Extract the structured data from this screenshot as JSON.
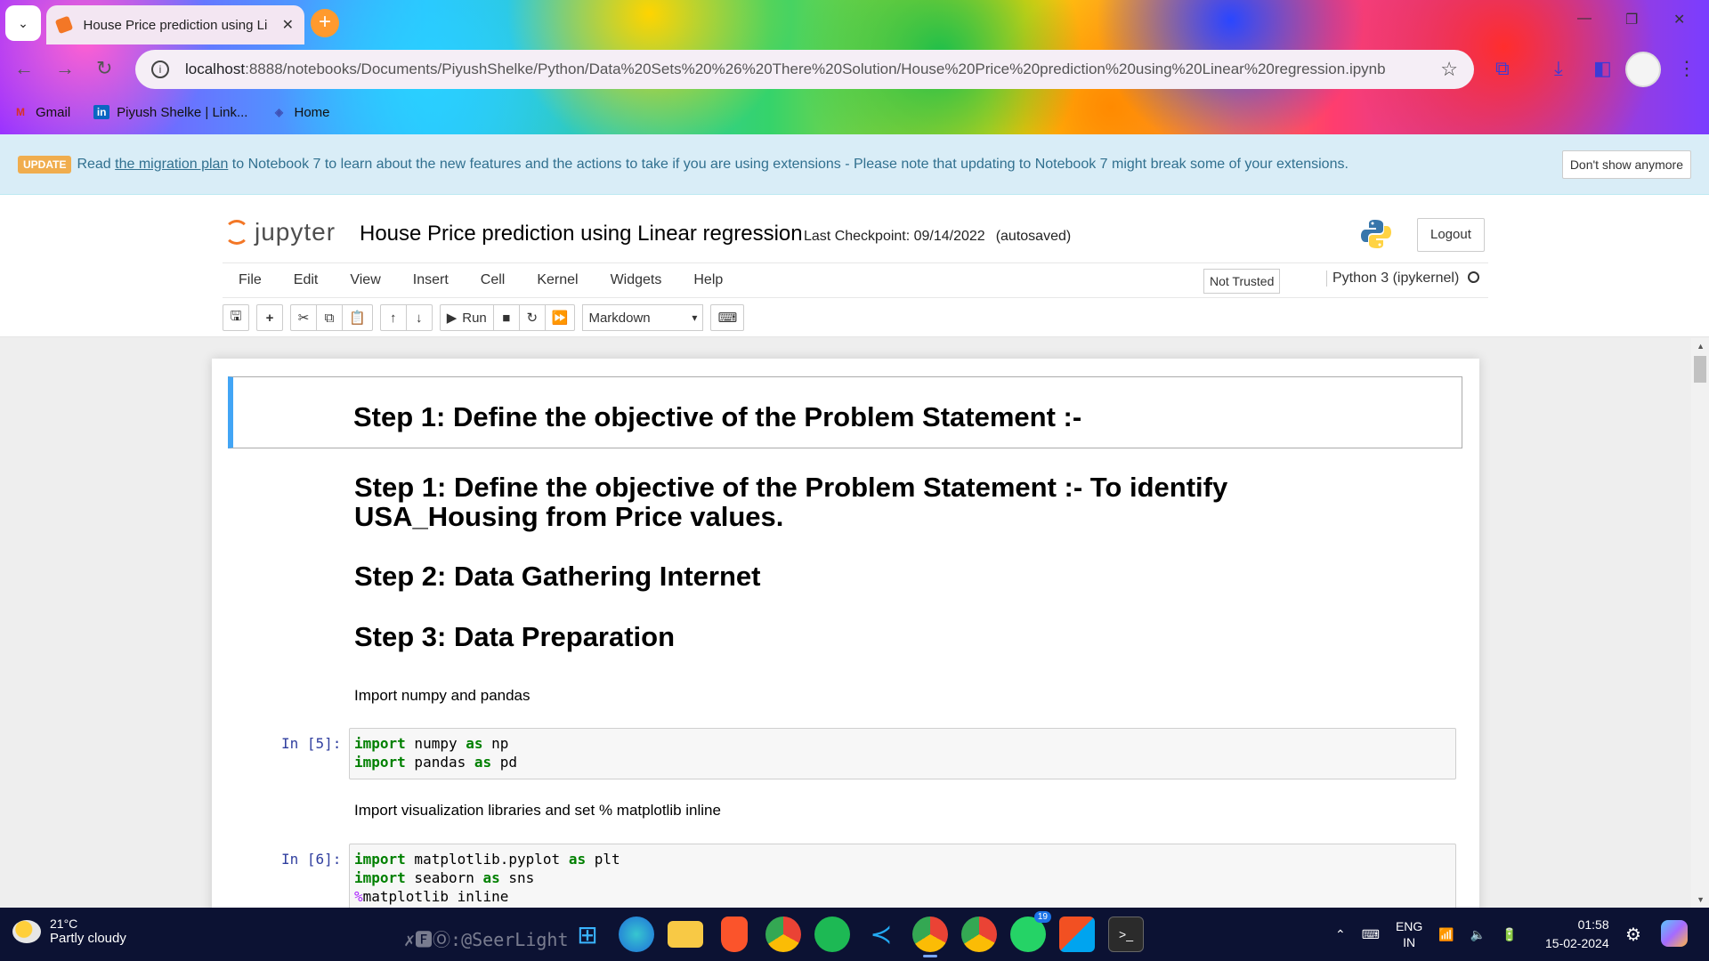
{
  "browser": {
    "tab_title": "House Price prediction using Li",
    "url_host": "localhost",
    "url_path": ":8888/notebooks/Documents/PiyushShelke/Python/Data%20Sets%20%26%20There%20Solution/House%20Price%20prediction%20using%20Linear%20regression.ipynb",
    "bookmarks": [
      {
        "label": "Gmail",
        "icon": "gmail-icon"
      },
      {
        "label": "Piyush Shelke | Link...",
        "icon": "linkedin-icon"
      },
      {
        "label": "Home",
        "icon": "home-icon"
      }
    ]
  },
  "banner": {
    "badge": "UPDATE",
    "text_before": "Read ",
    "link": "the migration plan",
    "text_after": " to Notebook 7 to learn about the new features and the actions to take if you are using extensions - Please note that updating to Notebook 7 might break some of your extensions.",
    "dismiss_label": "Don't show anymore"
  },
  "jupyter": {
    "logo_text": "jupyter",
    "notebook_title": "House Price prediction using Linear regression",
    "checkpoint": "Last Checkpoint: 09/14/2022",
    "autosave": "(autosaved)",
    "logout_label": "Logout",
    "menu": [
      "File",
      "Edit",
      "View",
      "Insert",
      "Cell",
      "Kernel",
      "Widgets",
      "Help"
    ],
    "trust_label": "Not Trusted",
    "kernel_label": "Python 3 (ipykernel)",
    "run_label": "Run",
    "cell_type": "Markdown"
  },
  "cells": {
    "selected_heading": "Step 1: Define the objective of the Problem Statement :-",
    "heading_step1": "Step 1: Define the objective of the Problem Statement :- To identify USA_Housing from Price values.",
    "heading_step2": "Step 2: Data Gathering Internet",
    "heading_step3": "Step 3: Data Preparation",
    "text_import": "Import numpy and pandas",
    "prompt5": "In [5]:",
    "text_viz": "Import visualization libraries and set % matplotlib inline",
    "prompt6": "In [6]:"
  },
  "taskbar": {
    "temperature": "21°C",
    "weather": "Partly cloudy",
    "watermark": "✗🅵Ⓞ:@SeerLight",
    "lang_top": "ENG",
    "lang_bottom": "IN",
    "time": "01:58",
    "date": "15-02-2024",
    "whatsapp_badge": "19"
  },
  "colors": {
    "jupyter_orange": "#f37726",
    "selected_cell_border": "#42a5f5",
    "keyword_green": "#008000",
    "prompt_blue": "#303f9f"
  }
}
